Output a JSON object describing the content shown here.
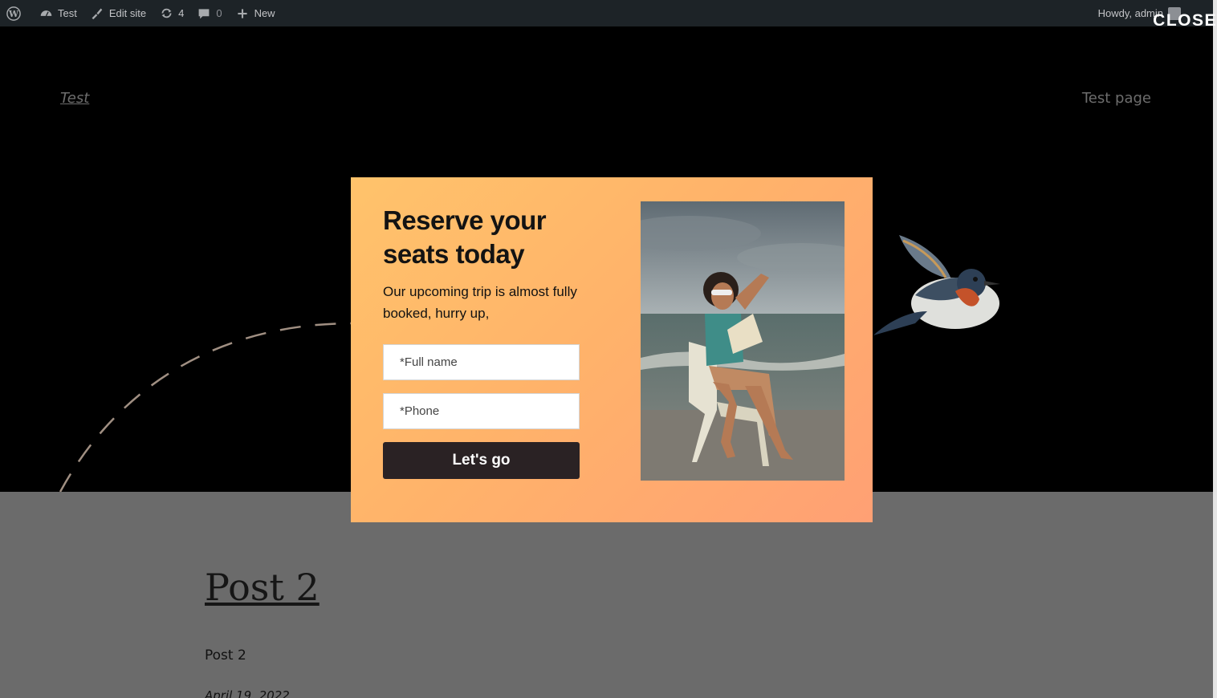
{
  "adminbar": {
    "site_name": "Test",
    "edit_site": "Edit site",
    "updates_count": "4",
    "comments_count": "0",
    "new_label": "New",
    "howdy": "Howdy, admin"
  },
  "site": {
    "title": "Test",
    "nav_link": "Test page"
  },
  "post": {
    "title": "Post 2",
    "body": "Post 2",
    "date": "April 19, 2022"
  },
  "popup": {
    "close_label": "CLOSE",
    "heading": "Reserve your seats today",
    "subtext": "Our upcoming trip is almost fully booked, hurry up,",
    "name_placeholder": "*Full name",
    "phone_placeholder": "*Phone",
    "button_label": "Let's go"
  },
  "colors": {
    "popup_gradient_start": "#ffc36b",
    "popup_gradient_end": "#ffa074",
    "button": "#2a2224",
    "adminbar": "#1d2327"
  }
}
